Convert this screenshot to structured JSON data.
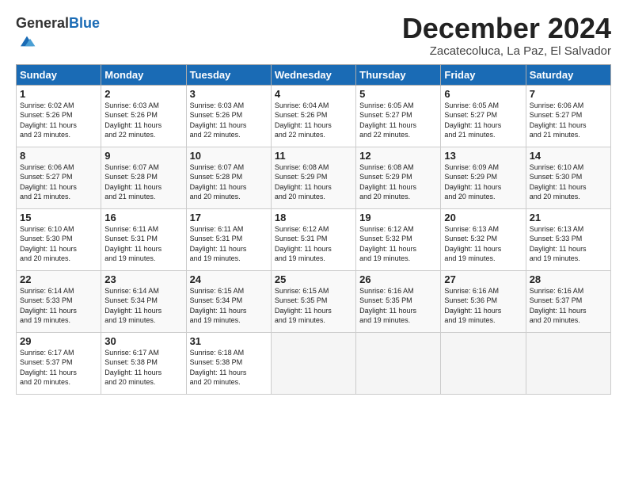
{
  "logo": {
    "general": "General",
    "blue": "Blue"
  },
  "title": "December 2024",
  "location": "Zacatecoluca, La Paz, El Salvador",
  "days_of_week": [
    "Sunday",
    "Monday",
    "Tuesday",
    "Wednesday",
    "Thursday",
    "Friday",
    "Saturday"
  ],
  "weeks": [
    [
      {
        "day": "1",
        "sunrise": "6:02 AM",
        "sunset": "5:26 PM",
        "daylight": "11 hours and 23 minutes."
      },
      {
        "day": "2",
        "sunrise": "6:03 AM",
        "sunset": "5:26 PM",
        "daylight": "11 hours and 22 minutes."
      },
      {
        "day": "3",
        "sunrise": "6:03 AM",
        "sunset": "5:26 PM",
        "daylight": "11 hours and 22 minutes."
      },
      {
        "day": "4",
        "sunrise": "6:04 AM",
        "sunset": "5:26 PM",
        "daylight": "11 hours and 22 minutes."
      },
      {
        "day": "5",
        "sunrise": "6:05 AM",
        "sunset": "5:27 PM",
        "daylight": "11 hours and 22 minutes."
      },
      {
        "day": "6",
        "sunrise": "6:05 AM",
        "sunset": "5:27 PM",
        "daylight": "11 hours and 21 minutes."
      },
      {
        "day": "7",
        "sunrise": "6:06 AM",
        "sunset": "5:27 PM",
        "daylight": "11 hours and 21 minutes."
      }
    ],
    [
      {
        "day": "8",
        "sunrise": "6:06 AM",
        "sunset": "5:27 PM",
        "daylight": "11 hours and 21 minutes."
      },
      {
        "day": "9",
        "sunrise": "6:07 AM",
        "sunset": "5:28 PM",
        "daylight": "11 hours and 21 minutes."
      },
      {
        "day": "10",
        "sunrise": "6:07 AM",
        "sunset": "5:28 PM",
        "daylight": "11 hours and 20 minutes."
      },
      {
        "day": "11",
        "sunrise": "6:08 AM",
        "sunset": "5:29 PM",
        "daylight": "11 hours and 20 minutes."
      },
      {
        "day": "12",
        "sunrise": "6:08 AM",
        "sunset": "5:29 PM",
        "daylight": "11 hours and 20 minutes."
      },
      {
        "day": "13",
        "sunrise": "6:09 AM",
        "sunset": "5:29 PM",
        "daylight": "11 hours and 20 minutes."
      },
      {
        "day": "14",
        "sunrise": "6:10 AM",
        "sunset": "5:30 PM",
        "daylight": "11 hours and 20 minutes."
      }
    ],
    [
      {
        "day": "15",
        "sunrise": "6:10 AM",
        "sunset": "5:30 PM",
        "daylight": "11 hours and 20 minutes."
      },
      {
        "day": "16",
        "sunrise": "6:11 AM",
        "sunset": "5:31 PM",
        "daylight": "11 hours and 19 minutes."
      },
      {
        "day": "17",
        "sunrise": "6:11 AM",
        "sunset": "5:31 PM",
        "daylight": "11 hours and 19 minutes."
      },
      {
        "day": "18",
        "sunrise": "6:12 AM",
        "sunset": "5:31 PM",
        "daylight": "11 hours and 19 minutes."
      },
      {
        "day": "19",
        "sunrise": "6:12 AM",
        "sunset": "5:32 PM",
        "daylight": "11 hours and 19 minutes."
      },
      {
        "day": "20",
        "sunrise": "6:13 AM",
        "sunset": "5:32 PM",
        "daylight": "11 hours and 19 minutes."
      },
      {
        "day": "21",
        "sunrise": "6:13 AM",
        "sunset": "5:33 PM",
        "daylight": "11 hours and 19 minutes."
      }
    ],
    [
      {
        "day": "22",
        "sunrise": "6:14 AM",
        "sunset": "5:33 PM",
        "daylight": "11 hours and 19 minutes."
      },
      {
        "day": "23",
        "sunrise": "6:14 AM",
        "sunset": "5:34 PM",
        "daylight": "11 hours and 19 minutes."
      },
      {
        "day": "24",
        "sunrise": "6:15 AM",
        "sunset": "5:34 PM",
        "daylight": "11 hours and 19 minutes."
      },
      {
        "day": "25",
        "sunrise": "6:15 AM",
        "sunset": "5:35 PM",
        "daylight": "11 hours and 19 minutes."
      },
      {
        "day": "26",
        "sunrise": "6:16 AM",
        "sunset": "5:35 PM",
        "daylight": "11 hours and 19 minutes."
      },
      {
        "day": "27",
        "sunrise": "6:16 AM",
        "sunset": "5:36 PM",
        "daylight": "11 hours and 19 minutes."
      },
      {
        "day": "28",
        "sunrise": "6:16 AM",
        "sunset": "5:37 PM",
        "daylight": "11 hours and 20 minutes."
      }
    ],
    [
      {
        "day": "29",
        "sunrise": "6:17 AM",
        "sunset": "5:37 PM",
        "daylight": "11 hours and 20 minutes."
      },
      {
        "day": "30",
        "sunrise": "6:17 AM",
        "sunset": "5:38 PM",
        "daylight": "11 hours and 20 minutes."
      },
      {
        "day": "31",
        "sunrise": "6:18 AM",
        "sunset": "5:38 PM",
        "daylight": "11 hours and 20 minutes."
      },
      null,
      null,
      null,
      null
    ]
  ]
}
